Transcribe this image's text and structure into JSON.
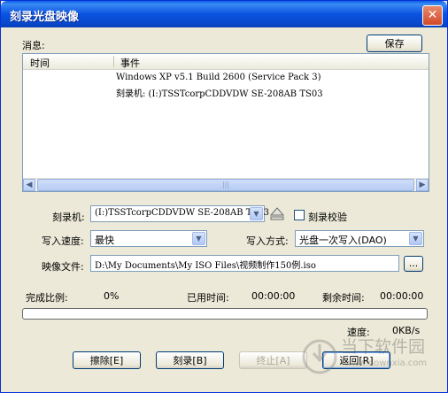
{
  "window": {
    "title": "刻录光盘映像",
    "close_symbol": "✕"
  },
  "messages": {
    "label": "消息:",
    "save_label": "保存",
    "columns": {
      "time": "时间",
      "event": "事件"
    },
    "rows": [
      "Windows XP v5.1 Build 2600 (Service Pack 3)",
      "刻录机: (I:)TSSTcorpCDDVDW SE-208AB TS03"
    ]
  },
  "burner": {
    "label": "刻录机:",
    "value": "(I:)TSSTcorpCDDVDW SE-208AB TS03",
    "verify_label": "刻录校验"
  },
  "speed": {
    "label": "写入速度:",
    "value": "最快"
  },
  "write_mode": {
    "label": "写入方式:",
    "value": "光盘一次写入(DAO)"
  },
  "image_file": {
    "label": "映像文件:",
    "value": "D:\\My Documents\\My ISO Files\\视频制作150例.iso",
    "browse_label": "..."
  },
  "progress": {
    "complete_label": "完成比例:",
    "complete_value": "0%",
    "elapsed_label": "已用时间:",
    "elapsed_value": "00:00:00",
    "remaining_label": "剩余时间:",
    "remaining_value": "00:00:00",
    "fraction": 0,
    "speed_label": "速度:",
    "speed_value": "0KB/s"
  },
  "buttons": {
    "erase": "擦除[E]",
    "burn": "刻录[B]",
    "stop": "终止[A]",
    "back": "返回[R]"
  },
  "watermark": {
    "text": "当下软件园",
    "url": "www.downxia.com"
  },
  "colors": {
    "titlebar": "#0a53e0",
    "dialog": "#ece9d8",
    "border": "#7f9db9"
  }
}
